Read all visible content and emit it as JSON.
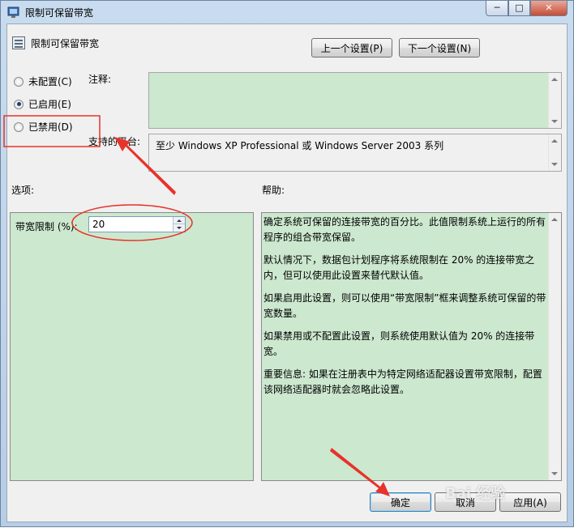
{
  "window": {
    "title": "限制可保留带宽",
    "controls": {
      "minimize": "─",
      "maximize": "□",
      "close": "✕"
    }
  },
  "header": {
    "title": "限制可保留带宽",
    "prev_button": "上一个设置(P)",
    "next_button": "下一个设置(N)"
  },
  "state": {
    "options": [
      {
        "label": "未配置(C)",
        "checked": false
      },
      {
        "label": "已启用(E)",
        "checked": true
      },
      {
        "label": "已禁用(D)",
        "checked": false
      }
    ]
  },
  "comment": {
    "label": "注释:",
    "value": ""
  },
  "platform": {
    "label": "支持的平台:",
    "value": "至少 Windows XP Professional 或 Windows Server 2003 系列"
  },
  "options_section": {
    "label": "选项:",
    "bandwidth_label": "带宽限制 (%):",
    "bandwidth_value": "20"
  },
  "help_section": {
    "label": "帮助:",
    "paragraphs": [
      "确定系统可保留的连接带宽的百分比。此值限制系统上运行的所有程序的组合带宽保留。",
      "默认情况下，数据包计划程序将系统限制在 20% 的连接带宽之内，但可以使用此设置来替代默认值。",
      "如果启用此设置，则可以使用“带宽限制”框来调整系统可保留的带宽数量。",
      "如果禁用或不配置此设置，则系统使用默认值为 20% 的连接带宽。",
      "重要信息: 如果在注册表中为特定网络适配器设置带宽限制，配置该网络适配器时就会忽略此设置。"
    ]
  },
  "footer": {
    "ok": "确定",
    "cancel": "取消",
    "apply": "应用(A)"
  },
  "watermark": "Bai 经验",
  "colors": {
    "panel_green": "#cce8cf",
    "annotation_red": "#e8322a",
    "dialog_bg": "#f0f0f0"
  }
}
